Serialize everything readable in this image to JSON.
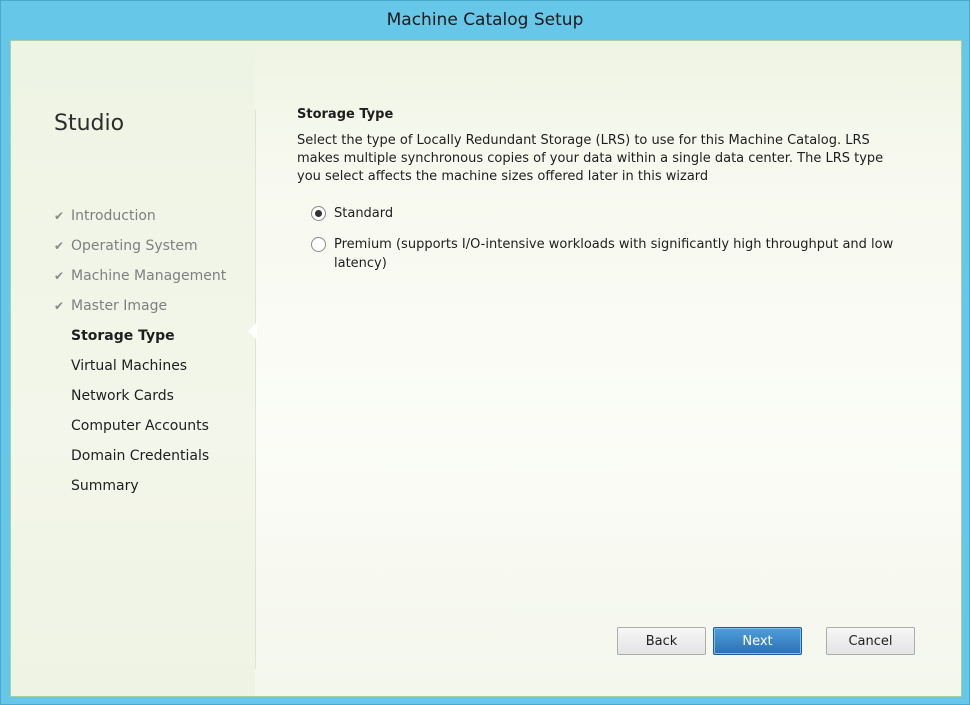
{
  "window": {
    "title": "Machine Catalog Setup"
  },
  "sidebar": {
    "brand": "Studio",
    "steps": [
      {
        "label": "Introduction",
        "state": "done"
      },
      {
        "label": "Operating System",
        "state": "done"
      },
      {
        "label": "Machine Management",
        "state": "done"
      },
      {
        "label": "Master Image",
        "state": "done"
      },
      {
        "label": "Storage Type",
        "state": "current"
      },
      {
        "label": "Virtual Machines",
        "state": "pending"
      },
      {
        "label": "Network Cards",
        "state": "pending"
      },
      {
        "label": "Computer Accounts",
        "state": "pending"
      },
      {
        "label": "Domain Credentials",
        "state": "pending"
      },
      {
        "label": "Summary",
        "state": "pending"
      }
    ],
    "check_glyph": "✔"
  },
  "main": {
    "heading": "Storage Type",
    "description": "Select the type of Locally Redundant Storage (LRS) to use for this Machine Catalog. LRS makes multiple synchronous copies of your data within a single data center. The LRS type you select affects the machine sizes offered later in this wizard",
    "options": [
      {
        "label": "Standard",
        "selected": true
      },
      {
        "label": "Premium (supports I/O-intensive workloads with significantly high throughput and low latency)",
        "selected": false
      }
    ]
  },
  "footer": {
    "back_label": "Back",
    "next_label": "Next",
    "cancel_label": "Cancel"
  },
  "colors": {
    "title_bar": "#66c7e8",
    "primary_button": "#2d6fb5"
  }
}
